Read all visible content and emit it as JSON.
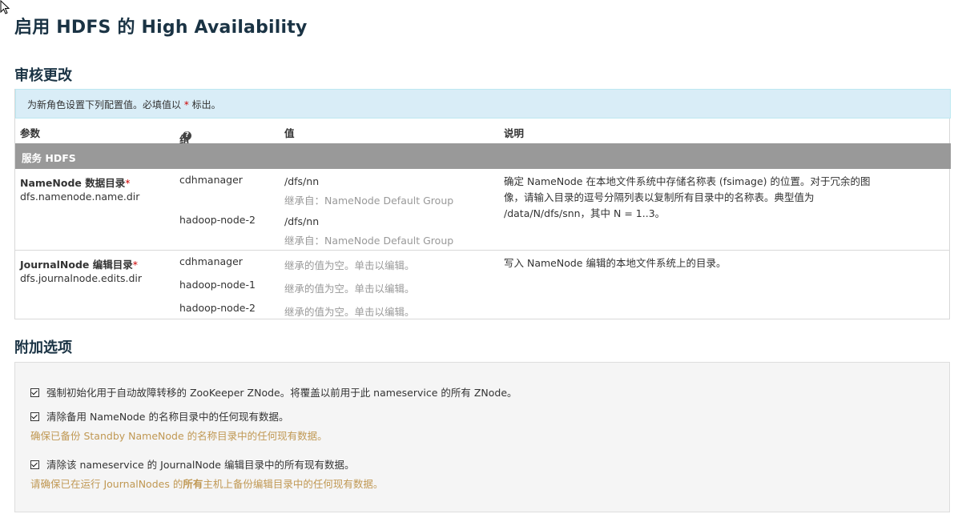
{
  "page": {
    "title": "启用 HDFS 的 High Availability"
  },
  "review": {
    "title": "审核更改",
    "info_prefix": "为新角色设置下列配置值。必填值以 ",
    "info_required_mark": "*",
    "info_suffix": " 标出。",
    "headers": {
      "param": "参数",
      "group": "组",
      "value": "值",
      "description": "说明"
    },
    "service_label": "服务 HDFS",
    "namenode": {
      "name": "NameNode 数据目录",
      "required_mark": "*",
      "key": "dfs.namenode.name.dir",
      "entries": [
        {
          "group": "cdhmanager",
          "value": "/dfs/nn",
          "inherit": "继承自：NameNode Default Group"
        },
        {
          "group": "hadoop-node-2",
          "value": "/dfs/nn",
          "inherit": "继承自：NameNode Default Group"
        }
      ],
      "description": "确定 NameNode 在本地文件系统中存储名称表 (fsimage) 的位置。对于冗余的图像，请输入目录的逗号分隔列表以复制所有目录中的名称表。典型值为 /data/N/dfs/snn，其中 N = 1..3。"
    },
    "journal": {
      "name": "JournalNode 编辑目录",
      "required_mark": "*",
      "key": "dfs.journalnode.edits.dir",
      "entries": [
        {
          "group": "cdhmanager",
          "value": "继承的值为空。单击以编辑。"
        },
        {
          "group": "hadoop-node-1",
          "value": "继承的值为空。单击以编辑。"
        },
        {
          "group": "hadoop-node-2",
          "value": "继承的值为空。单击以编辑。"
        }
      ],
      "description": "写入 NameNode 编辑的本地文件系统上的目录。"
    }
  },
  "options": {
    "title": "附加选项",
    "items": [
      {
        "label": "强制初始化用于自动故障转移的 ZooKeeper ZNode。将覆盖以前用于此 nameservice 的所有 ZNode。",
        "checked": true
      },
      {
        "label": "清除备用 NameNode 的名称目录中的任何现有数据。",
        "checked": true,
        "warning": "确保已备份 Standby NameNode 的名称目录中的任何现有数据。"
      },
      {
        "label": "清除该 nameservice 的 JournalNode 编辑目录中的所有现有数据。",
        "checked": true,
        "warning_prefix": "请确保已在运行 JournalNodes 的",
        "warning_bold": "所有",
        "warning_suffix": "主机上备份编辑目录中的任何现有数据。"
      }
    ]
  },
  "colors": {
    "title": "#1a3344",
    "info_bg": "#d9edf7",
    "service_bg": "#999999",
    "warning": "#c09853",
    "required": "#cc0000"
  }
}
